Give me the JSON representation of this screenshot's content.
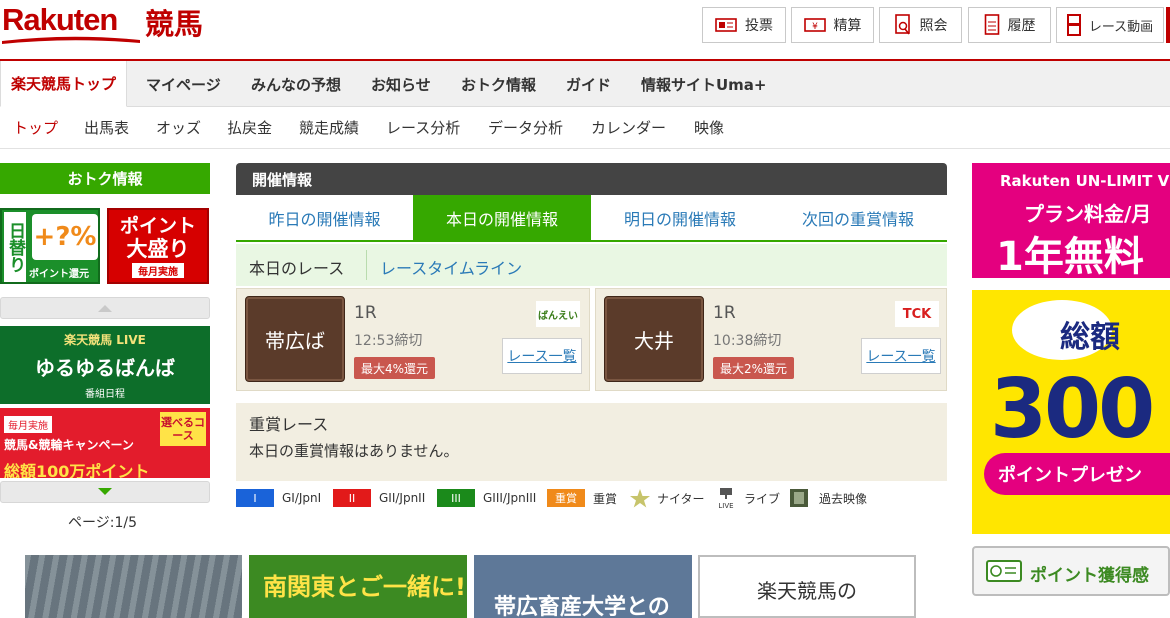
{
  "header": {
    "logo_text": "Rakuten",
    "logo_kanji": "競馬",
    "buttons": [
      {
        "label": "投票"
      },
      {
        "label": "精算"
      },
      {
        "label": "照会"
      },
      {
        "label": "履歴"
      },
      {
        "label": "レース動画"
      }
    ]
  },
  "main_nav": [
    {
      "label": "楽天競馬トップ",
      "active": true
    },
    {
      "label": "マイページ"
    },
    {
      "label": "みんなの予想"
    },
    {
      "label": "お知らせ"
    },
    {
      "label": "おトク情報"
    },
    {
      "label": "ガイド"
    },
    {
      "label": "情報サイトUma+"
    }
  ],
  "sub_nav": [
    {
      "label": "トップ",
      "active": true
    },
    {
      "label": "出馬表"
    },
    {
      "label": "オッズ"
    },
    {
      "label": "払戻金"
    },
    {
      "label": "競走成績"
    },
    {
      "label": "レース分析"
    },
    {
      "label": "データ分析"
    },
    {
      "label": "カレンダー"
    },
    {
      "label": "映像"
    }
  ],
  "left": {
    "title": "おトク情報",
    "banner1": {
      "line1": "日替り",
      "symbol": "+?%",
      "sub": "ポイント還元"
    },
    "banner2": {
      "line1": "ポイント",
      "line2": "大盛り",
      "sub": "毎月実施"
    },
    "banner3": {
      "top": "楽天競馬 LIVE",
      "main": "ゆるゆるばんば",
      "sub": "番組日程"
    },
    "banner4": {
      "tag": "毎月実施",
      "main": "競馬&競輪キャンペーン",
      "badge": "選べるコース",
      "bottom": "総額100万ポイント"
    },
    "page_indicator": "ページ:1/5"
  },
  "kaisai": {
    "title": "開催情報",
    "tabs": [
      {
        "label": "昨日の開催情報"
      },
      {
        "label": "本日の開催情報",
        "active": true
      },
      {
        "label": "明日の開催情報"
      },
      {
        "label": "次回の重賞情報"
      }
    ],
    "race_label": "本日のレース",
    "timeline_link": "レースタイムライン",
    "races": [
      {
        "venue": "帯広ば",
        "race_no": "1R",
        "deadline": "12:53締切",
        "rate": "最大4%還元",
        "list_link": "レース一覧",
        "logo": "ばんえい"
      },
      {
        "venue": "大井",
        "race_no": "1R",
        "deadline": "10:38締切",
        "rate": "最大2%還元",
        "list_link": "レース一覧",
        "logo": "TCK"
      }
    ],
    "juusho_title": "重賞レース",
    "juusho_msg": "本日の重賞情報はありません。"
  },
  "legend": [
    {
      "badge": "I",
      "label": "GI/JpnI",
      "color": "#1a63d9"
    },
    {
      "badge": "II",
      "label": "GII/JpnII",
      "color": "#e21a1a"
    },
    {
      "badge": "III",
      "label": "GIII/JpnIII",
      "color": "#1b8a1b"
    },
    {
      "badge": "重賞",
      "label": "重賞",
      "color": "#f08a1a"
    },
    {
      "label": "ナイター",
      "icon": "star-icon"
    },
    {
      "label": "ライブ",
      "icon": "live-icon"
    },
    {
      "label": "過去映像",
      "icon": "film-icon"
    }
  ],
  "bottom_tiles": [
    {
      "text": ""
    },
    {
      "text": "南関東とご一緒に!"
    },
    {
      "text": "帯広畜産大学との"
    },
    {
      "text": "楽天競馬の"
    }
  ],
  "right": {
    "ad1": {
      "brand": "Rakuten UN-LIMIT V",
      "line1": "プラン料金/月",
      "line2": "1年無料"
    },
    "ad2": {
      "top": "総額",
      "amount": "300",
      "bottom": "ポイントプレゼン"
    },
    "ad3": {
      "text": "ポイント獲得感"
    }
  },
  "colors": {
    "brand_red": "#bf0000",
    "green": "#36a800",
    "link_blue": "#2a7ab7",
    "dark_header": "#444444"
  }
}
